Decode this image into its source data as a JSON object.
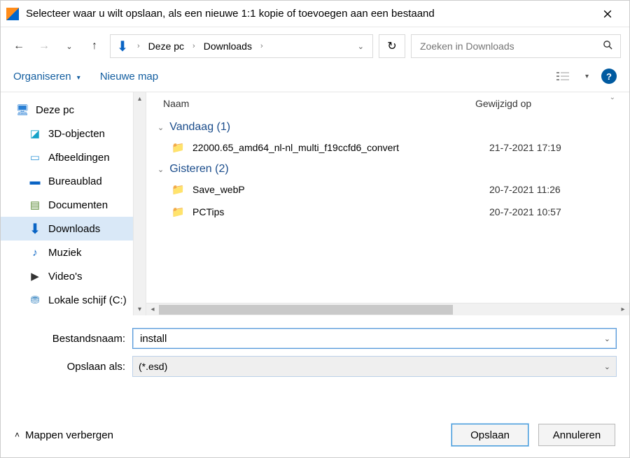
{
  "title": "Selecteer waar u wilt opslaan, als een nieuwe 1:1 kopie of toevoegen aan een bestaand",
  "breadcrumb": {
    "root": "Deze pc",
    "folder": "Downloads"
  },
  "search": {
    "placeholder": "Zoeken in Downloads"
  },
  "toolbar": {
    "organize": "Organiseren",
    "newfolder": "Nieuwe map"
  },
  "columns": {
    "name": "Naam",
    "modified": "Gewijzigd op"
  },
  "tree": {
    "root": "Deze pc",
    "items": [
      "3D-objecten",
      "Afbeeldingen",
      "Bureaublad",
      "Documenten",
      "Downloads",
      "Muziek",
      "Video's",
      "Lokale schijf (C:)"
    ]
  },
  "groups": [
    {
      "label": "Vandaag (1)",
      "items": [
        {
          "name": "22000.65_amd64_nl-nl_multi_f19ccfd6_convert",
          "date": "21-7-2021 17:19"
        }
      ]
    },
    {
      "label": "Gisteren (2)",
      "items": [
        {
          "name": "Save_webP",
          "date": "20-7-2021 11:26"
        },
        {
          "name": "PCTips",
          "date": "20-7-2021 10:57"
        }
      ]
    }
  ],
  "form": {
    "filename_label": "Bestandsnaam:",
    "filename_value": "install",
    "type_label": "Opslaan als:",
    "type_value": "(*.esd)"
  },
  "footer": {
    "toggle": "Mappen verbergen",
    "save": "Opslaan",
    "cancel": "Annuleren"
  }
}
